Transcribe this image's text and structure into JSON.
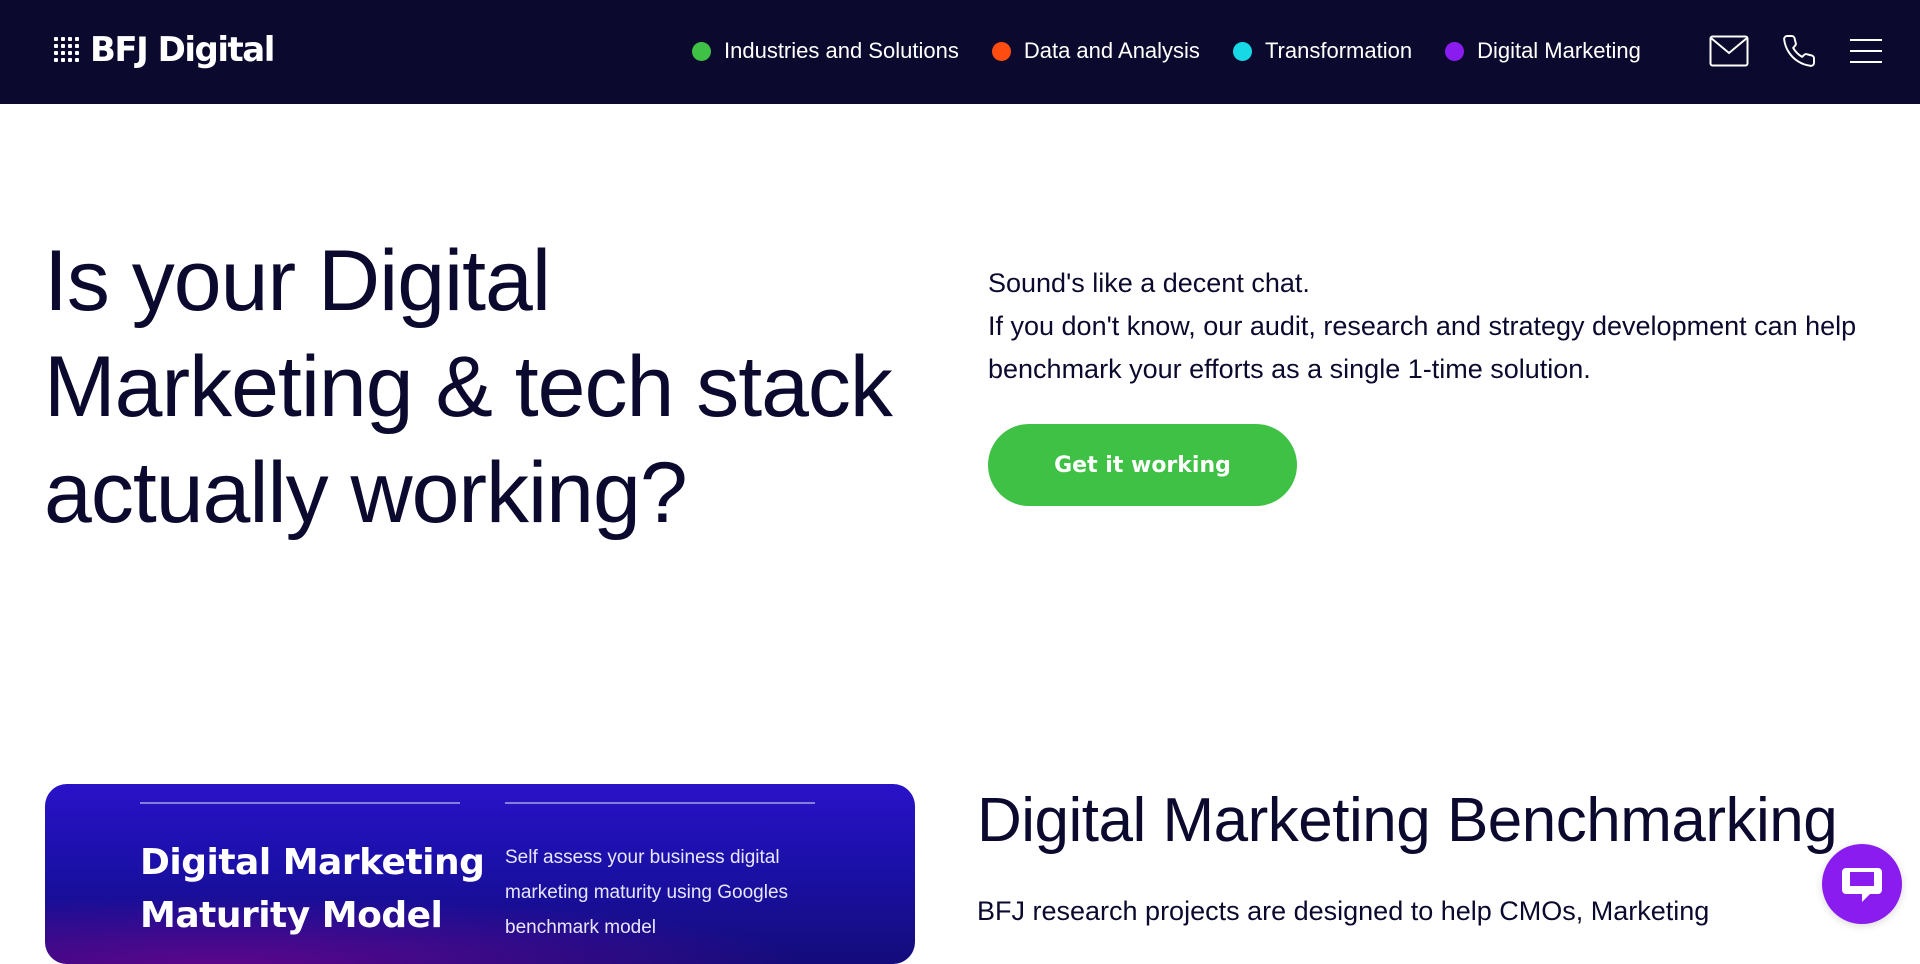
{
  "header": {
    "logo_text": "BFJ Digital",
    "nav": [
      {
        "label": "Industries and Solutions",
        "color": "#3ec144"
      },
      {
        "label": "Data and Analysis",
        "color": "#ff4d12"
      },
      {
        "label": "Transformation",
        "color": "#17d9e6"
      },
      {
        "label": "Digital Marketing",
        "color": "#8a1cf0"
      }
    ],
    "icons": {
      "mail": "mail-icon",
      "phone": "phone-icon",
      "menu": "menu-icon"
    }
  },
  "hero": {
    "title": "Is your Digital Marketing & tech stack actually working?",
    "intro_line": "Sound's like a decent chat.",
    "body": "If you don't know, our audit, research and strategy development can help benchmark your efforts as a single 1-time solution.",
    "cta_label": "Get it working"
  },
  "card": {
    "title": "Digital Marketing Maturity Model",
    "description": "Self assess your business digital marketing maturity using Googles benchmark model"
  },
  "section": {
    "title": "Digital Marketing Benchmarking",
    "text": "BFJ research projects are designed to help CMOs, Marketing"
  },
  "chat": {
    "icon": "chat-icon"
  },
  "colors": {
    "navy": "#0b0a2e",
    "green": "#3ec144",
    "purple": "#8a1cf0",
    "card": "#1b10a8"
  }
}
